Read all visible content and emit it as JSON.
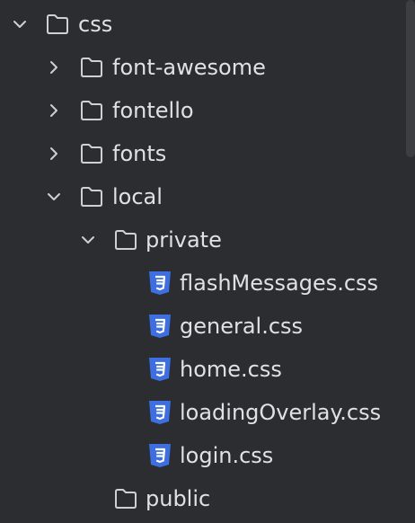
{
  "tree": {
    "items": [
      {
        "label": "css",
        "type": "folder",
        "expanded": true,
        "depth": 0,
        "icon": "folder-icon"
      },
      {
        "label": "font-awesome",
        "type": "folder",
        "expanded": false,
        "depth": 1,
        "icon": "folder-icon"
      },
      {
        "label": "fontello",
        "type": "folder",
        "expanded": false,
        "depth": 1,
        "icon": "folder-icon"
      },
      {
        "label": "fonts",
        "type": "folder",
        "expanded": false,
        "depth": 1,
        "icon": "folder-icon"
      },
      {
        "label": "local",
        "type": "folder",
        "expanded": true,
        "depth": 1,
        "icon": "folder-icon"
      },
      {
        "label": "private",
        "type": "folder",
        "expanded": true,
        "depth": 2,
        "icon": "folder-icon"
      },
      {
        "label": "flashMessages.css",
        "type": "file",
        "depth": 3,
        "icon": "css-file-icon"
      },
      {
        "label": "general.css",
        "type": "file",
        "depth": 3,
        "icon": "css-file-icon"
      },
      {
        "label": "home.css",
        "type": "file",
        "depth": 3,
        "icon": "css-file-icon"
      },
      {
        "label": "loadingOverlay.css",
        "type": "file",
        "depth": 3,
        "icon": "css-file-icon"
      },
      {
        "label": "login.css",
        "type": "file",
        "depth": 3,
        "icon": "css-file-icon"
      },
      {
        "label": "public",
        "type": "folder",
        "expanded": false,
        "depth": 2,
        "icon": "folder-icon"
      }
    ]
  },
  "colors": {
    "background": "#2b2d30",
    "text": "#dfe1e5",
    "icon_stroke": "#ced0d6",
    "css_badge": "#3d6fe0"
  }
}
